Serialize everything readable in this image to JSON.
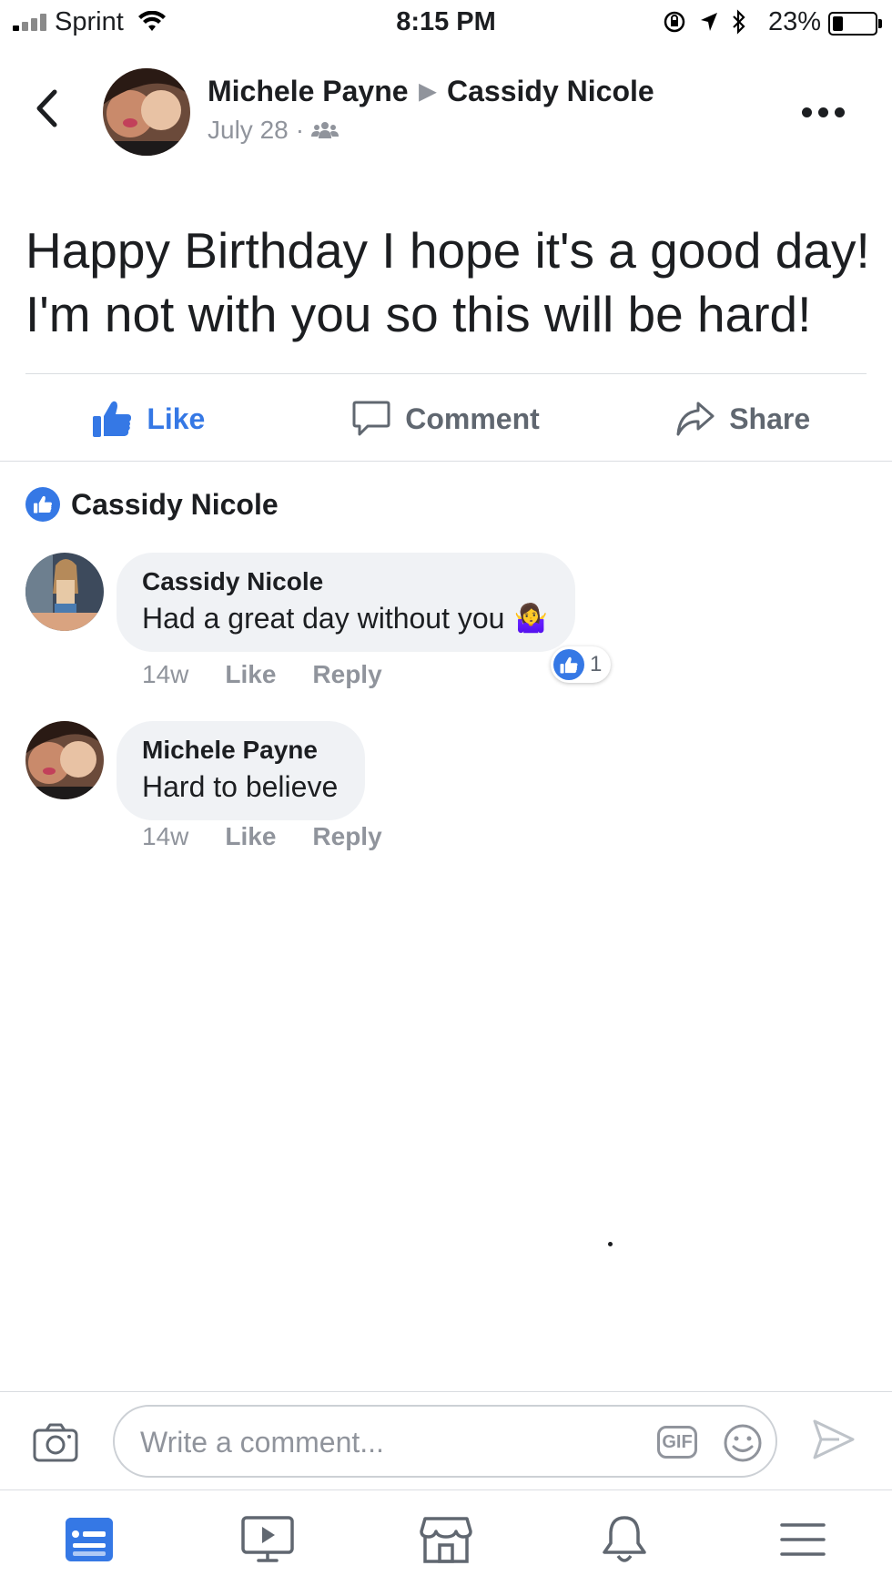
{
  "status_bar": {
    "carrier": "Sprint",
    "time": "8:15 PM",
    "battery_percent": "23%",
    "battery_level": 0.23
  },
  "post": {
    "author": "Michele Payne",
    "target": "Cassidy Nicole",
    "date": "July 28",
    "separator": "·",
    "privacy_icon": "friends-icon",
    "text_line1": "Happy Birthday I hope it's a good day!",
    "text_line2": "I'm not with you so this will be hard!",
    "actions": {
      "like": "Like",
      "comment": "Comment",
      "share": "Share"
    },
    "liked_by": "Cassidy Nicole"
  },
  "comments": [
    {
      "name": "Cassidy Nicole",
      "text": "Had a great day without you",
      "emoji": "🤷‍♀️",
      "age": "14w",
      "like": "Like",
      "reply": "Reply",
      "reaction_count": "1"
    },
    {
      "name": "Michele Payne",
      "text": "Hard to believe",
      "age": "14w",
      "like": "Like",
      "reply": "Reply"
    }
  ],
  "composer": {
    "placeholder": "Write a comment...",
    "gif_label": "GIF"
  },
  "tabbar": {
    "items": [
      "news-feed-icon",
      "watch-icon",
      "marketplace-icon",
      "notifications-icon",
      "menu-icon"
    ],
    "active": "news-feed-icon"
  },
  "colors": {
    "accent": "#3578e5",
    "muted": "#90949c",
    "bubble": "#f0f2f5"
  }
}
